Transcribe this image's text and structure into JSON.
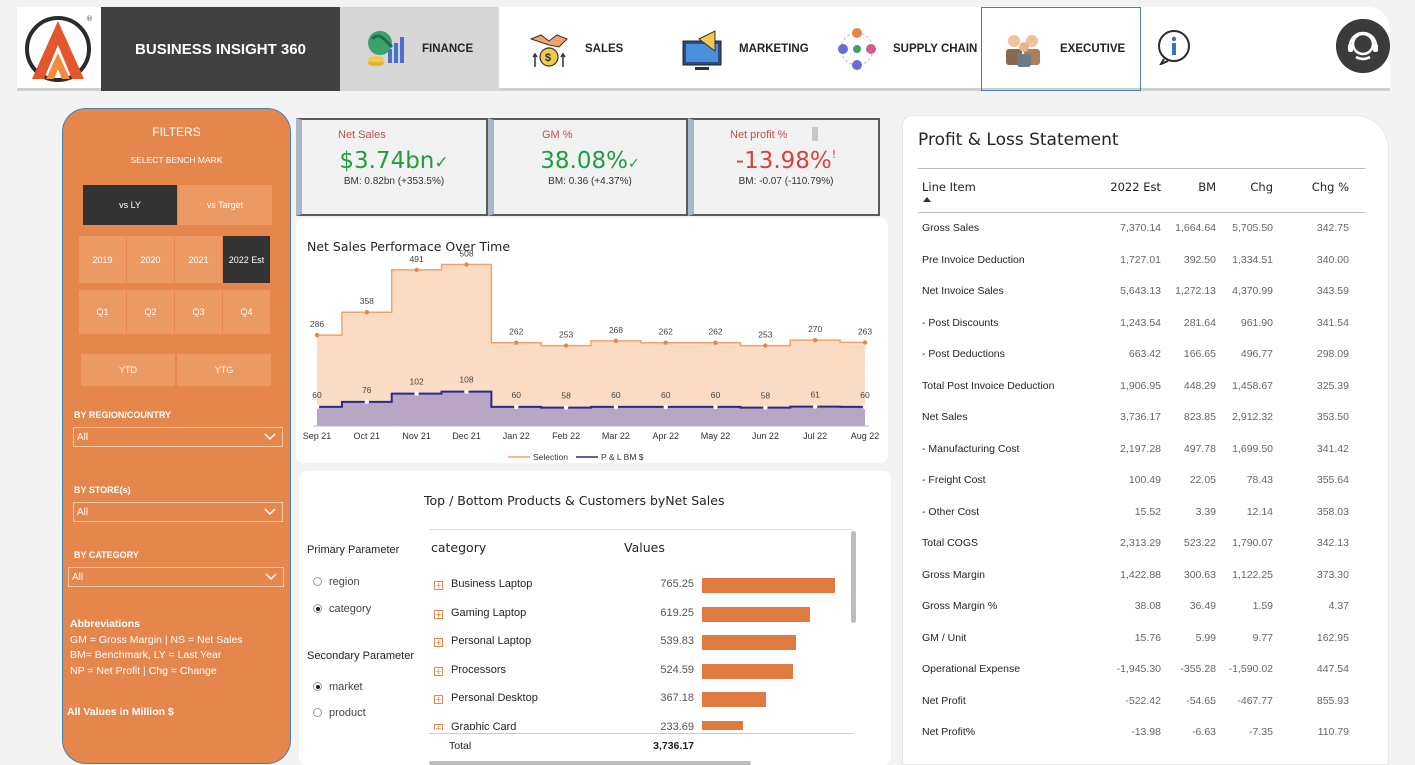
{
  "nav": {
    "brand": "BUSINESS INSIGHT 360",
    "tabs": [
      {
        "label": "FINANCE",
        "icon": "finance-globe-icon"
      },
      {
        "label": "SALES",
        "icon": "sales-handshake-icon"
      },
      {
        "label": "MARKETING",
        "icon": "marketing-megaphone-icon"
      },
      {
        "label": "SUPPLY CHAIN",
        "icon": "supply-chain-icon"
      },
      {
        "label": "EXECUTIVE",
        "icon": "executive-people-icon"
      }
    ]
  },
  "filters": {
    "title": "FILTERS",
    "subtitle": "SELECT BENCH MARK",
    "benchmark": [
      "vs LY",
      "vs Target"
    ],
    "years": [
      "2019",
      "2020",
      "2021",
      "2022 Est"
    ],
    "quarters": [
      "Q1",
      "Q2",
      "Q3",
      "Q4"
    ],
    "periods": [
      "YTD",
      "YTG"
    ],
    "region_label": "BY REGION/COUNTRY",
    "region_value": "All",
    "store_label": "BY STORE(s)",
    "store_value": "All",
    "category_label": "BY CATEGORY",
    "category_value": "All",
    "abbr_title": "Abbreviations",
    "abbr_lines": [
      "GM = Gross Margin | NS = Net  Sales",
      "BM= Benchmark, LY = Last Year",
      "NP = Net Profit | Chg = Change"
    ],
    "all_values": "All Values in Million $"
  },
  "kpis": [
    {
      "title": "Net Sales",
      "value": "$3.74bn",
      "mark": "✓",
      "bm": "BM: 0.82bn (+353.5%)",
      "color": "#1e9e3e"
    },
    {
      "title": "GM %",
      "value": "38.08%",
      "mark": "✓",
      "bm": "BM: 0.36 (+4.37%)",
      "color": "#1e9e3e"
    },
    {
      "title": "Net profit %",
      "value": "-13.98%",
      "mark": "!",
      "bm": "BM: -0.07 (-110.79%)",
      "color": "#d9423a"
    }
  ],
  "net_sales_chart": {
    "title": "Net Sales Performace Over Time",
    "legend": [
      "Selection",
      "P & L BM $"
    ]
  },
  "chart_data": {
    "type": "area",
    "categories": [
      "Sep 21",
      "Oct 21",
      "Nov 21",
      "Dec 21",
      "Jan 22",
      "Feb 22",
      "Mar 22",
      "Apr 22",
      "May 22",
      "Jun 22",
      "Jul 22",
      "Aug 22"
    ],
    "series": [
      {
        "name": "Selection",
        "values": [
          286,
          358,
          491,
          508,
          262,
          253,
          268,
          262,
          262,
          253,
          270,
          263
        ],
        "color": "#f0a36b"
      },
      {
        "name": "P & L BM $",
        "values": [
          60,
          76,
          102,
          108,
          60,
          58,
          60,
          60,
          60,
          58,
          61,
          60
        ],
        "color": "#2b2b8c"
      }
    ],
    "ylim": [
      0,
      560
    ],
    "step": true
  },
  "products": {
    "title": "Top / Bottom Products & Customers byNet Sales",
    "primary_label": "Primary Parameter",
    "primary_options": [
      "region",
      "category"
    ],
    "primary_selected": 1,
    "secondary_label": "Secondary Parameter",
    "secondary_options": [
      "market",
      "product"
    ],
    "secondary_selected": 0,
    "col_category": "category",
    "col_values": "Values",
    "rows": [
      {
        "name": "Business Laptop",
        "value": "765.25",
        "num": 765.25
      },
      {
        "name": "Gaming Laptop",
        "value": "619.25",
        "num": 619.25
      },
      {
        "name": "Personal Laptop",
        "value": "539.83",
        "num": 539.83
      },
      {
        "name": "Processors",
        "value": "524.59",
        "num": 524.59
      },
      {
        "name": "Personal Desktop",
        "value": "367.18",
        "num": 367.18
      },
      {
        "name": "Graphic Card",
        "value": "233.69",
        "num": 233.69
      }
    ],
    "total_label": "Total",
    "total_value": "3,736.17"
  },
  "pl": {
    "title": "Profit & Loss Statement",
    "headers": [
      "Line Item",
      "2022 Est",
      "BM",
      "Chg",
      "Chg %"
    ],
    "rows": [
      [
        "Gross Sales",
        "7,370.14",
        "1,664.64",
        "5,705.50",
        "342.75"
      ],
      [
        "Pre Invoice Deduction",
        "1,727.01",
        "392.50",
        "1,334.51",
        "340.00"
      ],
      [
        "Net Invoice Sales",
        "5,643.13",
        "1,272.13",
        "4,370.99",
        "343.59"
      ],
      [
        "- Post Discounts",
        "1,243.54",
        "281.64",
        "961.90",
        "341.54"
      ],
      [
        "- Post Deductions",
        "663.42",
        "166.65",
        "496.77",
        "298.09"
      ],
      [
        "Total Post Invoice Deduction",
        "1,906.95",
        "448.29",
        "1,458.67",
        "325.39"
      ],
      [
        "Net Sales",
        "3,736.17",
        "823.85",
        "2,912.32",
        "353.50"
      ],
      [
        "- Manufacturing Cost",
        "2,197.28",
        "497.78",
        "1,699.50",
        "341.42"
      ],
      [
        "- Freight Cost",
        "100.49",
        "22.05",
        "78.43",
        "355.64"
      ],
      [
        "- Other Cost",
        "15.52",
        "3.39",
        "12.14",
        "358.03"
      ],
      [
        "Total COGS",
        "2,313.29",
        "523.22",
        "1,790.07",
        "342.13"
      ],
      [
        "Gross Margin",
        "1,422.88",
        "300.63",
        "1,122.25",
        "373.30"
      ],
      [
        "Gross Margin %",
        "38.08",
        "36.49",
        "1.59",
        "4.37"
      ],
      [
        "GM / Unit",
        "15.76",
        "5.99",
        "9.77",
        "162.95"
      ],
      [
        "Operational Expense",
        "-1,945.30",
        "-355.28",
        "-1,590.02",
        "447.54"
      ],
      [
        "Net Profit",
        "-522.42",
        "-54.65",
        "-467.77",
        "855.93"
      ],
      [
        "Net Profit%",
        "-13.98",
        "-6.63",
        "-7.35",
        "110.79"
      ]
    ]
  }
}
